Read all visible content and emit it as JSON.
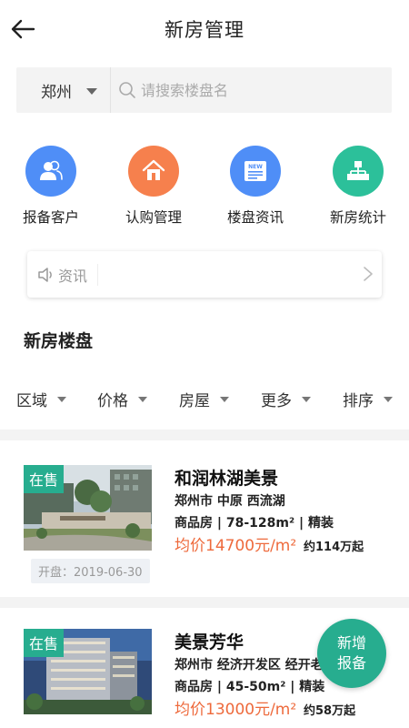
{
  "header": {
    "title": "新房管理"
  },
  "search": {
    "city": "郑州",
    "placeholder": "请搜索楼盘名"
  },
  "menu": [
    {
      "label": "报备客户",
      "icon": "users-icon",
      "color": "#4f8ef7"
    },
    {
      "label": "认购管理",
      "icon": "house-icon",
      "color": "#f6804d"
    },
    {
      "label": "楼盘资讯",
      "icon": "news-icon",
      "color": "#4f8ef7"
    },
    {
      "label": "新房统计",
      "icon": "hierarchy-icon",
      "color": "#2cc09a"
    }
  ],
  "news": {
    "label": "资讯"
  },
  "section": {
    "title": "新房楼盘"
  },
  "filters": [
    "区域",
    "价格",
    "房屋",
    "更多",
    "排序"
  ],
  "listings": [
    {
      "tag": "在售",
      "name": "和润林湖美景",
      "address": "郑州市 中原 西流湖",
      "type": "商品房 | 78-128m² | 精装",
      "price": "均价14700元/m²",
      "total": "约114万起",
      "open_date": "开盘：2019-06-30"
    },
    {
      "tag": "在售",
      "name": "美景芳华",
      "address": "郑州市 经济开发区 经开老",
      "type": "商品房 | 45-50m² | 精装",
      "price": "均价13000元/m²",
      "total": "约58万起"
    }
  ],
  "fab": {
    "line1": "新增",
    "line2": "报备"
  },
  "colors": {
    "accent": "#27ad8f",
    "price": "#ee6a3c"
  }
}
